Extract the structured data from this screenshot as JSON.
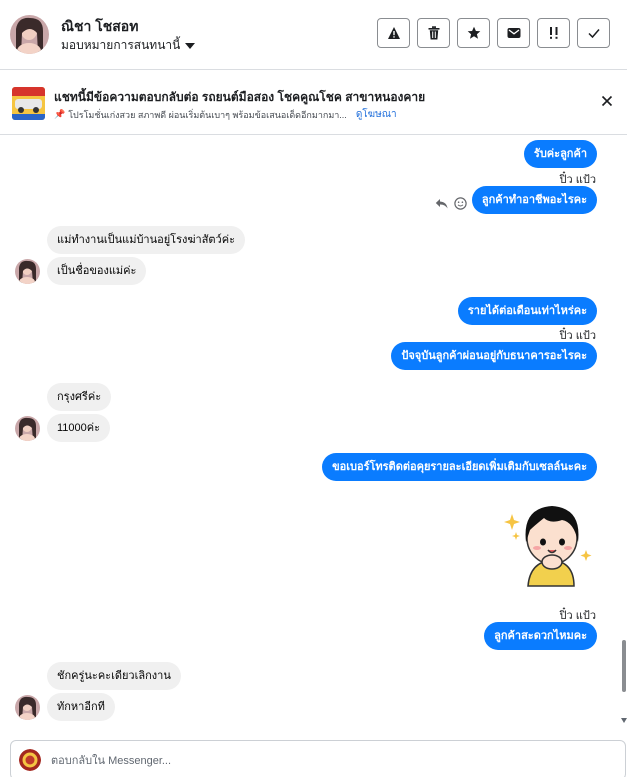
{
  "header": {
    "contact_name": "ณิชา โชสอท",
    "assign_label": "มอบหมายการสนทนานี้",
    "actions": [
      {
        "icon": "warning-icon",
        "label": "!"
      },
      {
        "icon": "trash-icon",
        "label": ""
      },
      {
        "icon": "star-icon",
        "label": ""
      },
      {
        "icon": "mail-icon",
        "label": ""
      },
      {
        "icon": "important-icon",
        "label": "!!"
      },
      {
        "icon": "check-icon",
        "label": ""
      }
    ]
  },
  "banner": {
    "title": "แชทนี้มีข้อความตอบกลับต่อ รถยนต์มือสอง โชคคูณโชค สาขาหนองคาย",
    "subtitle": "โปรโมชั่นเก่งสวย สภาพดี ผ่อนเริ่มต้นเบาๆ พร้อมข้อเสนอเด็ดอีกมากมา...",
    "link": "ดูโฆษณา"
  },
  "messages": {
    "m1": "รับค่ะลูกค้า",
    "seen1": "ปิ๋ว แป้ว",
    "m2": "ลูกค้าทำอาชีพอะไรคะ",
    "m3": "แม่ทำงานเป็นแม่บ้านอยู่โรงฆ่าสัตว์ค่ะ",
    "m4": "เป็นชื่อของแม่ค่ะ",
    "m5": "รายได้ต่อเดือนเท่าไหร่คะ",
    "seen2": "ปิ๋ว แป้ว",
    "m6": "ปัจจุบันลูกค้าผ่อนอยู่กับธนาคารอะไรคะ",
    "m7": "กรุงศรีค่ะ",
    "m8": "11000ค่ะ",
    "m9": "ขอเบอร์โทรติดต่อคุยรายละเอียดเพิ่มเติมกับเซลล์นะคะ",
    "seen3": "ปิ๋ว แป้ว",
    "m10": "ลูกค้าสะดวกไหมคะ",
    "m11": "ชักครู่นะคะเดียวเลิกงาน",
    "m12": "ทักหาอีกที"
  },
  "composer": {
    "placeholder": "ตอบกลับใน Messenger..."
  },
  "colors": {
    "outgoing_bubble": "#0a7cff",
    "incoming_bubble": "#f0f0f0",
    "link": "#216fdb"
  }
}
